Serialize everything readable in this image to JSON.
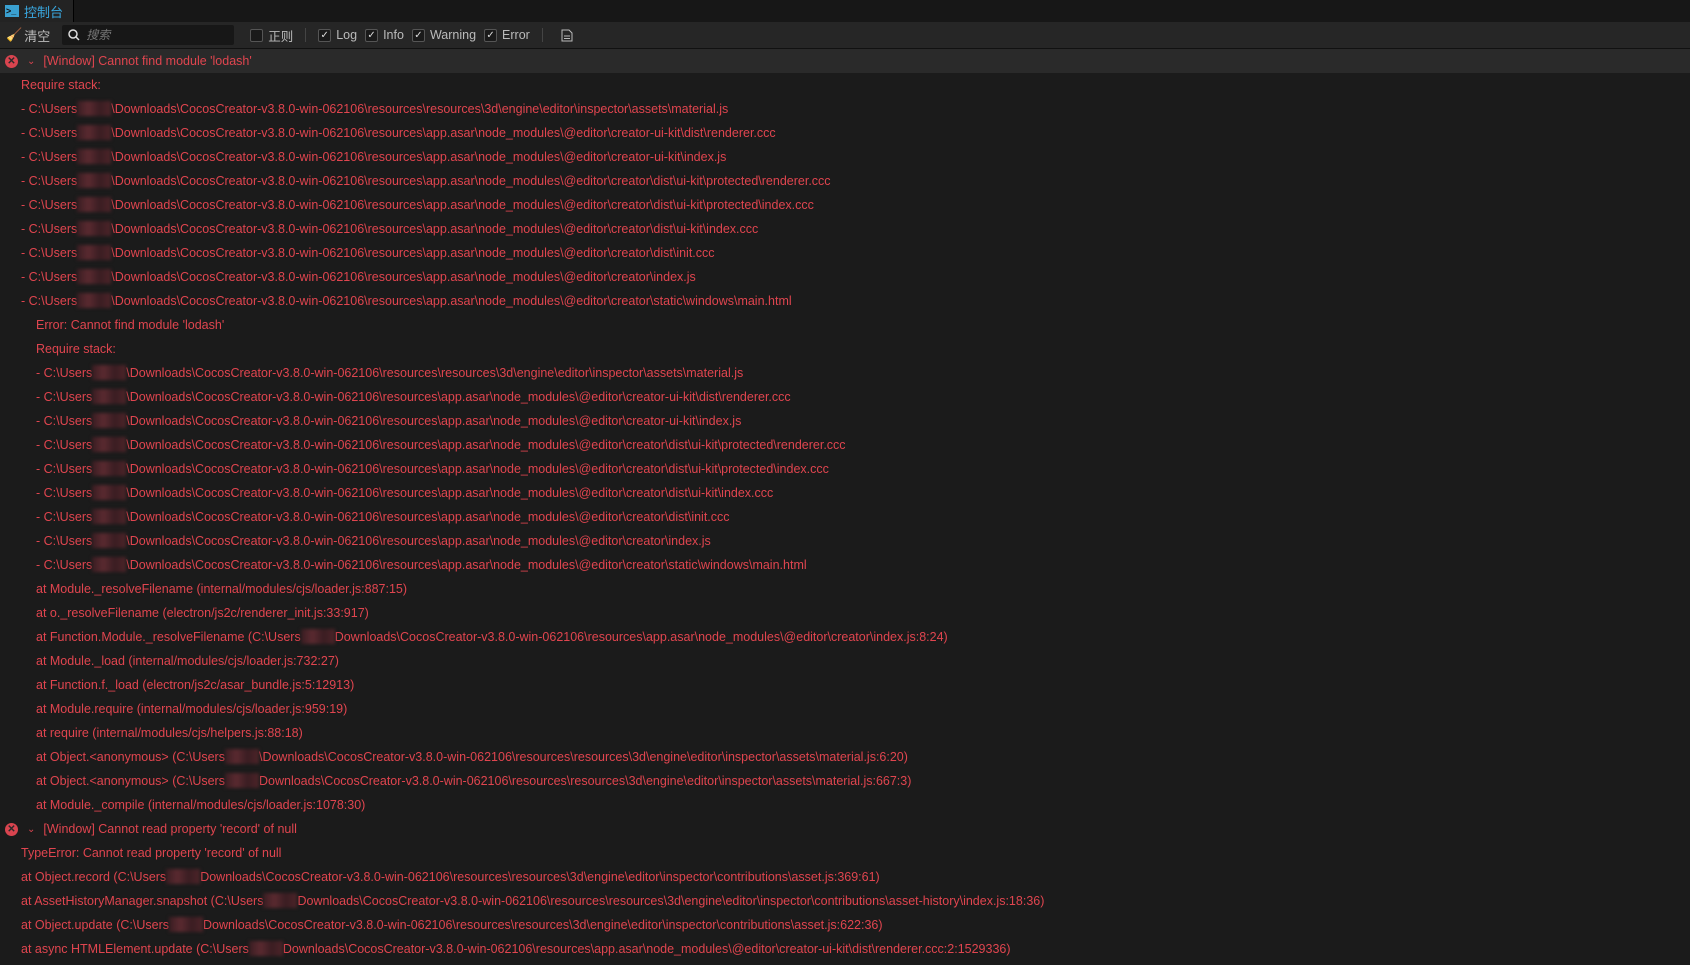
{
  "tab": {
    "label": "控制台",
    "icon": "terminal-icon"
  },
  "toolbar": {
    "clear": "清空",
    "search_placeholder": "搜索",
    "regex": "正则",
    "filters": [
      {
        "label": "Log",
        "checked": true
      },
      {
        "label": "Info",
        "checked": true
      },
      {
        "label": "Warning",
        "checked": true
      },
      {
        "label": "Error",
        "checked": true
      }
    ]
  },
  "colors": {
    "error": "#e0454f",
    "accent": "#39a8e0"
  },
  "groups": [
    {
      "title": "[Window] Cannot find module 'lodash'",
      "lines": [
        {
          "level": 1,
          "text": "Require stack:"
        },
        {
          "level": 1,
          "pre": "- C:\\Users",
          "post": "\\Downloads\\CocosCreator-v3.8.0-win-062106\\resources\\resources\\3d\\engine\\editor\\inspector\\assets\\material.js"
        },
        {
          "level": 1,
          "pre": "- C:\\Users",
          "post": "\\Downloads\\CocosCreator-v3.8.0-win-062106\\resources\\app.asar\\node_modules\\@editor\\creator-ui-kit\\dist\\renderer.ccc"
        },
        {
          "level": 1,
          "pre": "- C:\\Users",
          "post": "\\Downloads\\CocosCreator-v3.8.0-win-062106\\resources\\app.asar\\node_modules\\@editor\\creator-ui-kit\\index.js"
        },
        {
          "level": 1,
          "pre": "- C:\\Users",
          "post": "\\Downloads\\CocosCreator-v3.8.0-win-062106\\resources\\app.asar\\node_modules\\@editor\\creator\\dist\\ui-kit\\protected\\renderer.ccc"
        },
        {
          "level": 1,
          "pre": "- C:\\Users",
          "post": "\\Downloads\\CocosCreator-v3.8.0-win-062106\\resources\\app.asar\\node_modules\\@editor\\creator\\dist\\ui-kit\\protected\\index.ccc"
        },
        {
          "level": 1,
          "pre": "- C:\\Users",
          "post": "\\Downloads\\CocosCreator-v3.8.0-win-062106\\resources\\app.asar\\node_modules\\@editor\\creator\\dist\\ui-kit\\index.ccc"
        },
        {
          "level": 1,
          "pre": "- C:\\Users",
          "post": "\\Downloads\\CocosCreator-v3.8.0-win-062106\\resources\\app.asar\\node_modules\\@editor\\creator\\dist\\init.ccc"
        },
        {
          "level": 1,
          "pre": "- C:\\Users",
          "post": "\\Downloads\\CocosCreator-v3.8.0-win-062106\\resources\\app.asar\\node_modules\\@editor\\creator\\index.js"
        },
        {
          "level": 1,
          "pre": "- C:\\Users",
          "post": "\\Downloads\\CocosCreator-v3.8.0-win-062106\\resources\\app.asar\\node_modules\\@editor\\creator\\static\\windows\\main.html"
        },
        {
          "level": 2,
          "text": "Error: Cannot find module 'lodash'"
        },
        {
          "level": 2,
          "text": "Require stack:"
        },
        {
          "level": 2,
          "pre": "- C:\\Users",
          "post": "\\Downloads\\CocosCreator-v3.8.0-win-062106\\resources\\resources\\3d\\engine\\editor\\inspector\\assets\\material.js"
        },
        {
          "level": 2,
          "pre": "- C:\\Users",
          "post": "\\Downloads\\CocosCreator-v3.8.0-win-062106\\resources\\app.asar\\node_modules\\@editor\\creator-ui-kit\\dist\\renderer.ccc"
        },
        {
          "level": 2,
          "pre": "- C:\\Users",
          "post": "\\Downloads\\CocosCreator-v3.8.0-win-062106\\resources\\app.asar\\node_modules\\@editor\\creator-ui-kit\\index.js"
        },
        {
          "level": 2,
          "pre": "- C:\\Users",
          "post": "\\Downloads\\CocosCreator-v3.8.0-win-062106\\resources\\app.asar\\node_modules\\@editor\\creator\\dist\\ui-kit\\protected\\renderer.ccc"
        },
        {
          "level": 2,
          "pre": "- C:\\Users",
          "post": "\\Downloads\\CocosCreator-v3.8.0-win-062106\\resources\\app.asar\\node_modules\\@editor\\creator\\dist\\ui-kit\\protected\\index.ccc"
        },
        {
          "level": 2,
          "pre": "- C:\\Users",
          "post": "\\Downloads\\CocosCreator-v3.8.0-win-062106\\resources\\app.asar\\node_modules\\@editor\\creator\\dist\\ui-kit\\index.ccc"
        },
        {
          "level": 2,
          "pre": "- C:\\Users",
          "post": "\\Downloads\\CocosCreator-v3.8.0-win-062106\\resources\\app.asar\\node_modules\\@editor\\creator\\dist\\init.ccc"
        },
        {
          "level": 2,
          "pre": "- C:\\Users",
          "post": "\\Downloads\\CocosCreator-v3.8.0-win-062106\\resources\\app.asar\\node_modules\\@editor\\creator\\index.js"
        },
        {
          "level": 2,
          "pre": "- C:\\Users",
          "post": "\\Downloads\\CocosCreator-v3.8.0-win-062106\\resources\\app.asar\\node_modules\\@editor\\creator\\static\\windows\\main.html"
        },
        {
          "level": 2,
          "text": "at Module._resolveFilename (internal/modules/cjs/loader.js:887:15)"
        },
        {
          "level": 2,
          "text": "at o._resolveFilename (electron/js2c/renderer_init.js:33:917)"
        },
        {
          "level": 2,
          "pre": "at Function.Module._resolveFilename (C:\\Users",
          "post": "Downloads\\CocosCreator-v3.8.0-win-062106\\resources\\app.asar\\node_modules\\@editor\\creator\\index.js:8:24)"
        },
        {
          "level": 2,
          "text": "at Module._load (internal/modules/cjs/loader.js:732:27)"
        },
        {
          "level": 2,
          "text": "at Function.f._load (electron/js2c/asar_bundle.js:5:12913)"
        },
        {
          "level": 2,
          "text": "at Module.require (internal/modules/cjs/loader.js:959:19)"
        },
        {
          "level": 2,
          "text": "at require (internal/modules/cjs/helpers.js:88:18)"
        },
        {
          "level": 2,
          "pre": "at Object.<anonymous> (C:\\Users",
          "post": "\\Downloads\\CocosCreator-v3.8.0-win-062106\\resources\\resources\\3d\\engine\\editor\\inspector\\assets\\material.js:6:20)"
        },
        {
          "level": 2,
          "pre": "at Object.<anonymous> (C:\\Users",
          "post": "Downloads\\CocosCreator-v3.8.0-win-062106\\resources\\resources\\3d\\engine\\editor\\inspector\\assets\\material.js:667:3)"
        },
        {
          "level": 2,
          "text": "at Module._compile (internal/modules/cjs/loader.js:1078:30)"
        }
      ]
    },
    {
      "title": "[Window] Cannot read property 'record' of null",
      "lines": [
        {
          "level": 1,
          "text": "TypeError: Cannot read property 'record' of null"
        },
        {
          "level": 1,
          "pre": "at Object.record (C:\\Users",
          "post": "Downloads\\CocosCreator-v3.8.0-win-062106\\resources\\resources\\3d\\engine\\editor\\inspector\\contributions\\asset.js:369:61)"
        },
        {
          "level": 1,
          "pre": "at AssetHistoryManager.snapshot (C:\\Users",
          "post": "Downloads\\CocosCreator-v3.8.0-win-062106\\resources\\resources\\3d\\engine\\editor\\inspector\\contributions\\asset-history\\index.js:18:36)"
        },
        {
          "level": 1,
          "pre": "at Object.update (C:\\Users",
          "post": "Downloads\\CocosCreator-v3.8.0-win-062106\\resources\\resources\\3d\\engine\\editor\\inspector\\contributions\\asset.js:622:36)"
        },
        {
          "level": 1,
          "pre": "at async HTMLElement.update (C:\\Users",
          "post": "Downloads\\CocosCreator-v3.8.0-win-062106\\resources\\app.asar\\node_modules\\@editor\\creator-ui-kit\\dist\\renderer.ccc:2:1529336)"
        }
      ]
    }
  ]
}
